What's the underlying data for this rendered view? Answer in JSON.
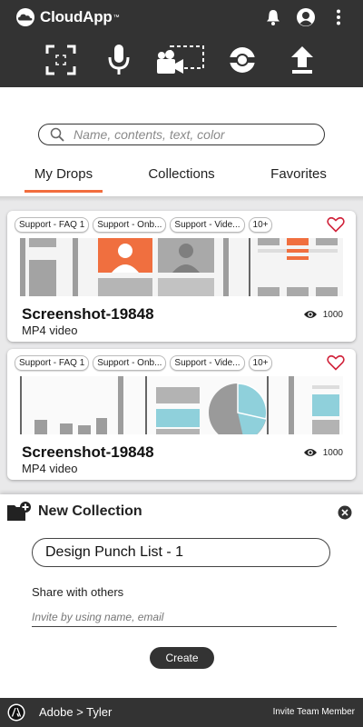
{
  "app": {
    "brand": "CloudApp",
    "brand_mark": "™",
    "accent_color": "#f26d3d",
    "dark_color": "#333333"
  },
  "header": {
    "icons": [
      "notification-bell-icon",
      "profile-icon",
      "more-vert-icon"
    ],
    "capture_tools": [
      "screenshot-capture-icon",
      "audio-record-icon",
      "video-record-icon",
      "gif-record-icon",
      "upload-icon"
    ]
  },
  "search": {
    "placeholder": "Name, contents, text, color"
  },
  "tabs": [
    {
      "label": "My Drops",
      "active": true
    },
    {
      "label": "Collections",
      "active": false
    },
    {
      "label": "Favorites",
      "active": false
    }
  ],
  "drops": [
    {
      "tags": [
        "Support - FAQ 1",
        "Support - Onb...",
        "Support - Vide...",
        "10+"
      ],
      "title": "Screenshot-19848",
      "subtitle": "MP4 video",
      "views": "1000"
    },
    {
      "tags": [
        "Support - FAQ 1",
        "Support - Onb...",
        "Support - Vide...",
        "10+"
      ],
      "title": "Screenshot-19848",
      "subtitle": "MP4 video",
      "views": "1000"
    }
  ],
  "new_collection": {
    "title": "New Collection",
    "name_value": "Design Punch List - 1",
    "share_label": "Share with others",
    "invite_placeholder": "Invite by using name, email",
    "create_label": "Create"
  },
  "footer": {
    "org": "Adobe > Tyler",
    "invite_label": "Invite Team Member"
  }
}
